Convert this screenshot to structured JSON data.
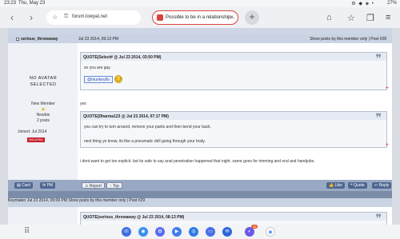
{
  "status": {
    "time": "23:23",
    "date": "Thu, May 23",
    "signal": "⚙ ◆ ◈ •",
    "battery": "27%"
  },
  "browser": {
    "back_icon": "chevron-left-icon",
    "url": "forum.lowyat.net",
    "tab_title": "Possible to be in a relationship...",
    "tab_close": "×",
    "new_tab": "+"
  },
  "post1": {
    "author": "serious_throwaway",
    "date": "Jul 23 2014, 09:13 PM",
    "show_posts": "Show posts by this member only | Post #28",
    "avatar_line1": "NO AVATAR",
    "avatar_line2": "SELECTED",
    "rank": "New Member",
    "group": "Newbie",
    "posts": "2 posts",
    "joined": "Joined: Jul 2014",
    "flag_text": "MALAYSIA",
    "quote1": {
      "header": "QUOTE(Select# @ Jul 23 2014, 03:50 PM)",
      "text": "so you are gay.",
      "mention": "@munkeyflo",
      "emoji": "•‿•"
    },
    "reply1": "yes",
    "quote2": {
      "header": "QUOTE(Dharma123 @ Jul 23 2014, 07:17 PM)",
      "line1": "you can try to turn around, remove your pants and then bend your back.",
      "line2": "next thing ye know, its like a pneumatic drill going through your body."
    },
    "reply2": "i dont want to get too explicit. but its safe to say anal penetration happened that night. same goes for rimming and oral and handjobs.",
    "buttons": {
      "card": "Card",
      "pm": "PM",
      "report": "Report",
      "top": "Top",
      "like": "Like",
      "quote": "Quote",
      "reply": "Reply"
    }
  },
  "post2": {
    "author": "Keymaker",
    "date": "Jul 23 2014, 09:09 PM",
    "show_posts": "Show posts by this member only | Post #29",
    "quote_header": "QUOTE(serious_throwaway @ Jul 23 2014, 08:13 PM)"
  },
  "taskbar": {
    "grid_icon": "⠿",
    "badge": "10"
  },
  "colors": {
    "header": "#cad3e3",
    "footer": "#9aa9c3",
    "button": "#4e6791",
    "tab_border": "#d9453c"
  }
}
